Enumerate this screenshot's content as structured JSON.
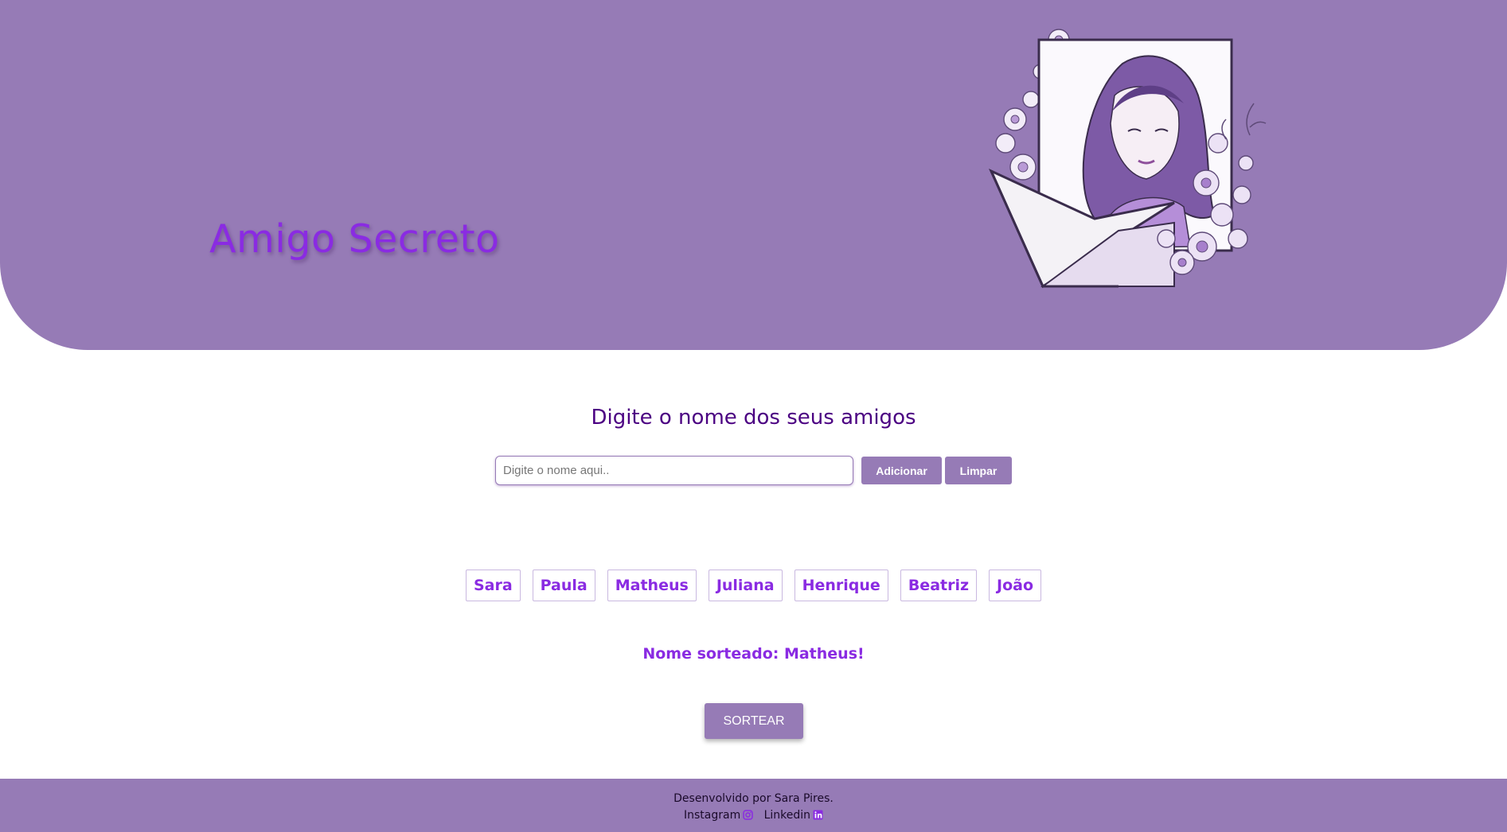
{
  "header": {
    "title": "Amigo Secreto",
    "illustration_icon": "woman-envelope-flowers-illustration"
  },
  "main": {
    "subtitle": "Digite o nome dos seus amigos",
    "input_placeholder": "Digite o nome aqui..",
    "input_value": "",
    "add_label": "Adicionar",
    "clear_label": "Limpar",
    "friends": [
      "Sara",
      "Paula",
      "Matheus",
      "Juliana",
      "Henrique",
      "Beatriz",
      "João"
    ],
    "result": "Nome sorteado: Matheus!",
    "draw_label": "SORTEAR"
  },
  "footer": {
    "credit": "Desenvolvido por Sara Pires.",
    "instagram_label": "Instagram",
    "linkedin_label": "Linkedin",
    "instagram_icon": "instagram-icon",
    "linkedin_icon": "linkedin-icon"
  },
  "colors": {
    "primary": "#967bb6",
    "accent": "#8a2be2",
    "subtitle": "#4b0082",
    "background": "#ffffff"
  }
}
